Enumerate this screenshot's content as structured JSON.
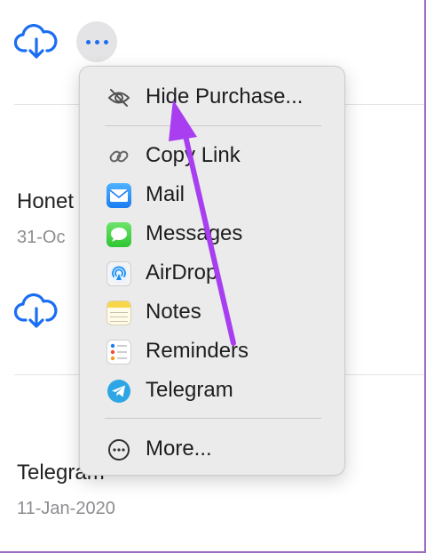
{
  "list": {
    "apps": [
      {
        "name": "Honet",
        "date": "31-Oc"
      },
      {
        "name": "Telegram",
        "date": "11-Jan-2020"
      }
    ]
  },
  "icons": {
    "download": "cloud-download-icon",
    "more": "ellipsis-icon"
  },
  "menu": {
    "hide_purchase": "Hide Purchase...",
    "share_items": [
      {
        "label": "Copy Link",
        "icon": "link-icon"
      },
      {
        "label": "Mail",
        "icon": "mail-icon"
      },
      {
        "label": "Messages",
        "icon": "messages-icon"
      },
      {
        "label": "AirDrop",
        "icon": "airdrop-icon"
      },
      {
        "label": "Notes",
        "icon": "notes-icon"
      },
      {
        "label": "Reminders",
        "icon": "reminders-icon"
      },
      {
        "label": "Telegram",
        "icon": "telegram-icon"
      }
    ],
    "more": "More..."
  },
  "colors": {
    "accent": "#1b6ef3",
    "annotation_arrow": "#a83ef0",
    "menu_background": "#ebebeb"
  }
}
